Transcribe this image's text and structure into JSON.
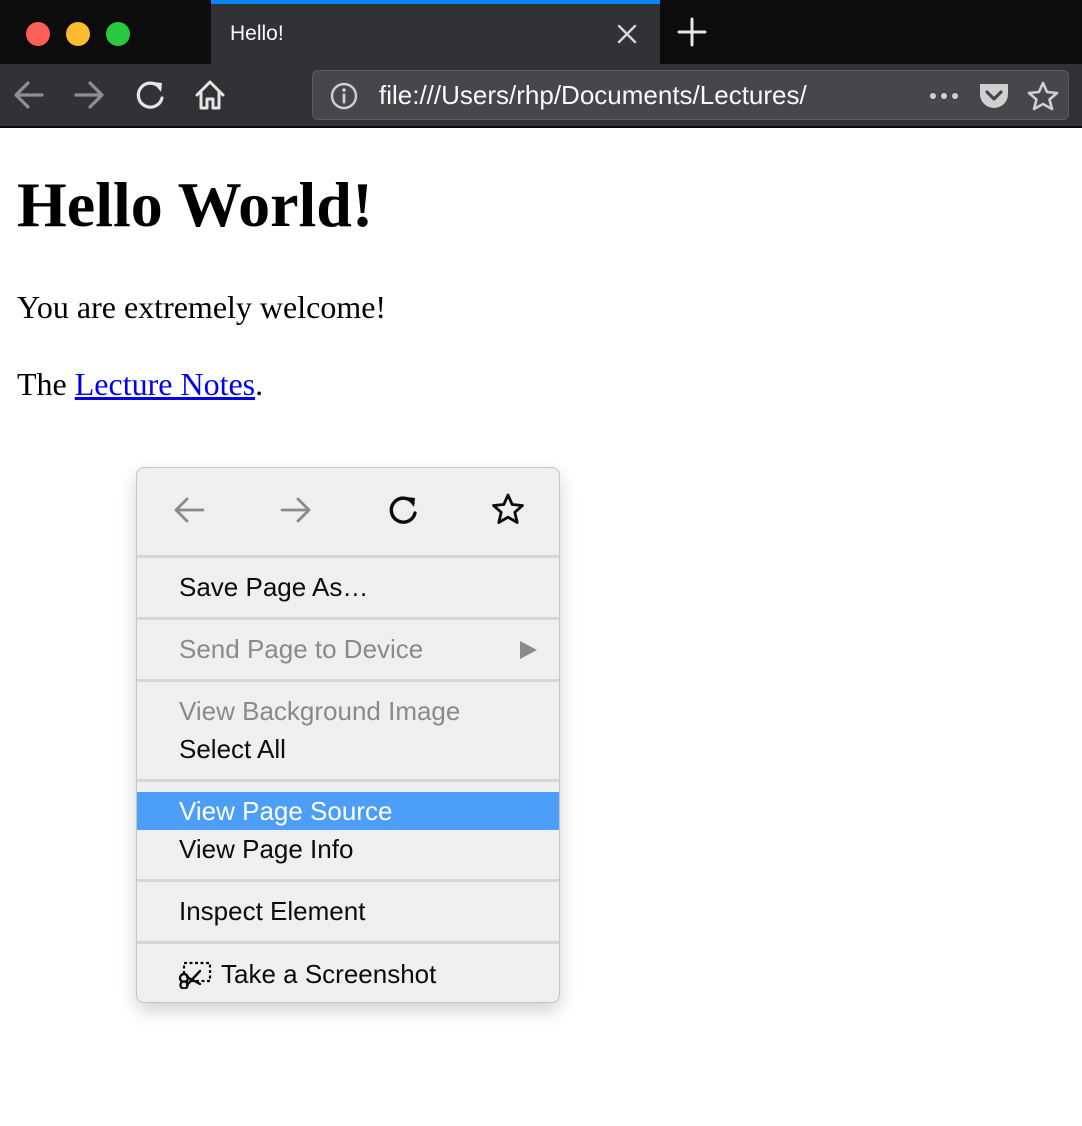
{
  "window": {
    "controls": [
      "close-dot",
      "minimize-dot",
      "zoom-dot"
    ]
  },
  "tab": {
    "title": "Hello!"
  },
  "navbar": {
    "url": "file:///Users/rhp/Documents/Lectures/",
    "icons": [
      "back-arrow-icon",
      "forward-arrow-icon",
      "reload-icon",
      "home-icon",
      "info-icon",
      "more-actions-icon",
      "pocket-icon",
      "bookmark-star-icon"
    ]
  },
  "page": {
    "heading": "Hello World!",
    "paragraph1": "You are extremely welcome!",
    "paragraph2_prefix": "The ",
    "link_text": "Lecture Notes",
    "paragraph2_suffix": "."
  },
  "context_menu": {
    "nav_icons": [
      "back-arrow-icon",
      "forward-arrow-icon",
      "reload-icon",
      "bookmark-star-icon"
    ],
    "items": [
      {
        "label": "Save Page As…",
        "enabled": true
      },
      {
        "label": "Send Page to Device",
        "enabled": false,
        "submenu": true
      },
      {
        "label": "View Background Image",
        "enabled": false
      },
      {
        "label": "Select All",
        "enabled": true
      },
      {
        "label": "View Page Source",
        "enabled": true,
        "highlighted": true
      },
      {
        "label": "View Page Info",
        "enabled": true
      },
      {
        "label": "Inspect Element",
        "enabled": true
      },
      {
        "label": "Take a Screenshot",
        "enabled": true,
        "icon": "screenshot-scissors-icon"
      }
    ],
    "highlight_color": "#4d9ef8"
  },
  "colors": {
    "tabstrip": "#0c0c0d",
    "toolbar": "#323234",
    "tab_accent": "#0a84ff",
    "link": "#0000ee"
  }
}
